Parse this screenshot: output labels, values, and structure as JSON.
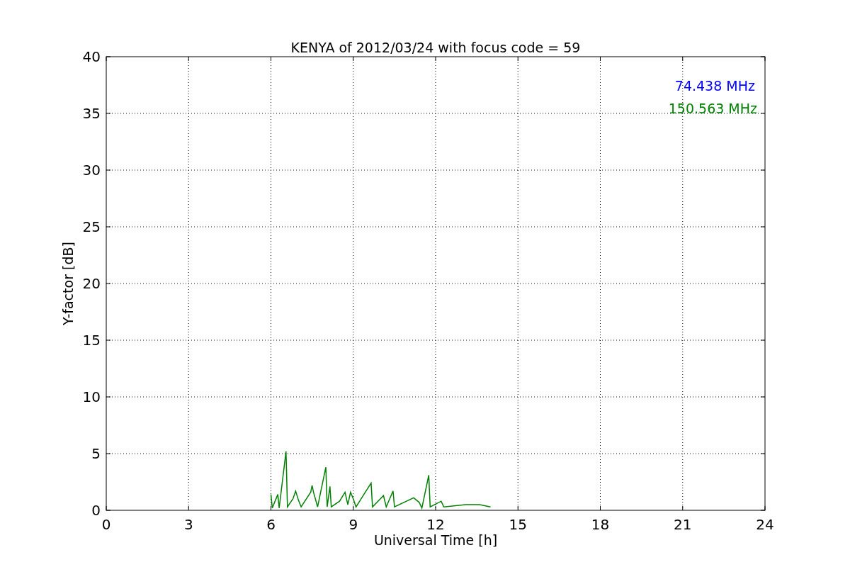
{
  "chart_data": {
    "type": "line",
    "title": "KENYA of 2012/03/24 with focus code = 59",
    "xlabel": "Universal Time [h]",
    "ylabel": "Y-factor [dB]",
    "x": [
      6.0,
      6.05,
      6.25,
      6.3,
      6.55,
      6.6,
      6.8,
      6.9,
      7.0,
      7.1,
      7.45,
      7.5,
      7.55,
      7.7,
      8.0,
      8.05,
      8.15,
      8.2,
      8.5,
      8.7,
      8.8,
      8.9,
      9.0,
      9.1,
      9.65,
      9.7,
      10.1,
      10.2,
      10.45,
      10.5,
      11.2,
      11.4,
      11.5,
      11.75,
      11.8,
      12.2,
      12.3,
      13.1,
      13.6,
      14.0
    ],
    "series": [
      {
        "name": "74.438 MHz",
        "color": "#0000ff",
        "values": [
          null,
          null,
          null,
          null,
          null,
          null,
          null,
          null,
          null,
          null,
          null,
          null,
          null,
          null,
          null,
          null,
          null,
          null,
          null,
          null,
          null,
          null,
          null,
          null,
          null,
          null,
          null,
          null,
          null,
          null,
          null,
          null,
          null,
          null,
          null,
          null,
          null,
          null,
          null,
          null
        ]
      },
      {
        "name": "150.563 MHz",
        "color": "#008000",
        "values": [
          1.4,
          0.2,
          1.4,
          0.2,
          5.2,
          0.3,
          1.0,
          1.7,
          0.9,
          0.3,
          1.6,
          2.2,
          1.6,
          0.3,
          3.8,
          0.3,
          2.1,
          0.3,
          0.8,
          1.6,
          0.5,
          1.6,
          1.0,
          0.3,
          2.4,
          0.3,
          1.3,
          0.3,
          1.7,
          0.3,
          1.1,
          0.7,
          0.2,
          3.1,
          0.3,
          0.8,
          0.3,
          0.5,
          0.5,
          0.3
        ]
      }
    ],
    "xlim": [
      0,
      24
    ],
    "ylim": [
      0,
      40
    ],
    "xticks": [
      0,
      3,
      6,
      9,
      12,
      15,
      18,
      21,
      24
    ],
    "yticks": [
      0,
      5,
      10,
      15,
      20,
      25,
      30,
      35,
      40
    ],
    "grid": true
  }
}
